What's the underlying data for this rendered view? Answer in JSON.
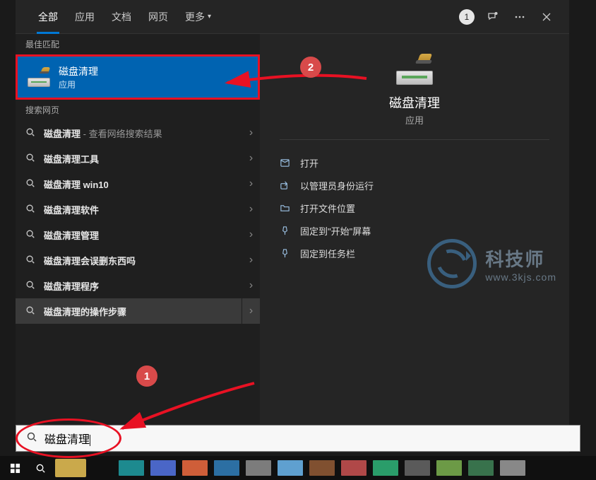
{
  "tabs": {
    "all": "全部",
    "apps": "应用",
    "docs": "文档",
    "web": "网页",
    "more": "更多"
  },
  "header": {
    "badge": "1"
  },
  "sections": {
    "best_match": "最佳匹配",
    "search_web": "搜索网页"
  },
  "best": {
    "title": "磁盘清理",
    "subtitle": "应用"
  },
  "web_results": [
    {
      "label": "磁盘清理",
      "suffix": " - 查看网络搜索结果"
    },
    {
      "label": "磁盘清理工具",
      "suffix": ""
    },
    {
      "label": "磁盘清理 win10",
      "suffix": ""
    },
    {
      "label": "磁盘清理软件",
      "suffix": ""
    },
    {
      "label": "磁盘清理管理",
      "suffix": ""
    },
    {
      "label": "磁盘清理会误删东西吗",
      "suffix": ""
    },
    {
      "label": "磁盘清理程序",
      "suffix": ""
    },
    {
      "label": "磁盘清理的操作步骤",
      "suffix": ""
    }
  ],
  "preview": {
    "title": "磁盘清理",
    "subtitle": "应用"
  },
  "actions": {
    "open": "打开",
    "run_admin": "以管理员身份运行",
    "open_location": "打开文件位置",
    "pin_start": "固定到\"开始\"屏幕",
    "pin_taskbar": "固定到任务栏"
  },
  "search": {
    "value": "磁盘清理"
  },
  "annotations": {
    "n1": "1",
    "n2": "2"
  },
  "watermark": {
    "name": "科技师",
    "url": "www.3kjs.com"
  },
  "taskbar_colors": [
    "#1d8a8f",
    "#4a66c7",
    "#cf5e39",
    "#2c6fa3",
    "#7c7c7c",
    "#5fa0d0",
    "#805030",
    "#b04848",
    "#2a9d6a",
    "#5a5a5a",
    "#6c9a46",
    "#38724c",
    "#888888"
  ]
}
